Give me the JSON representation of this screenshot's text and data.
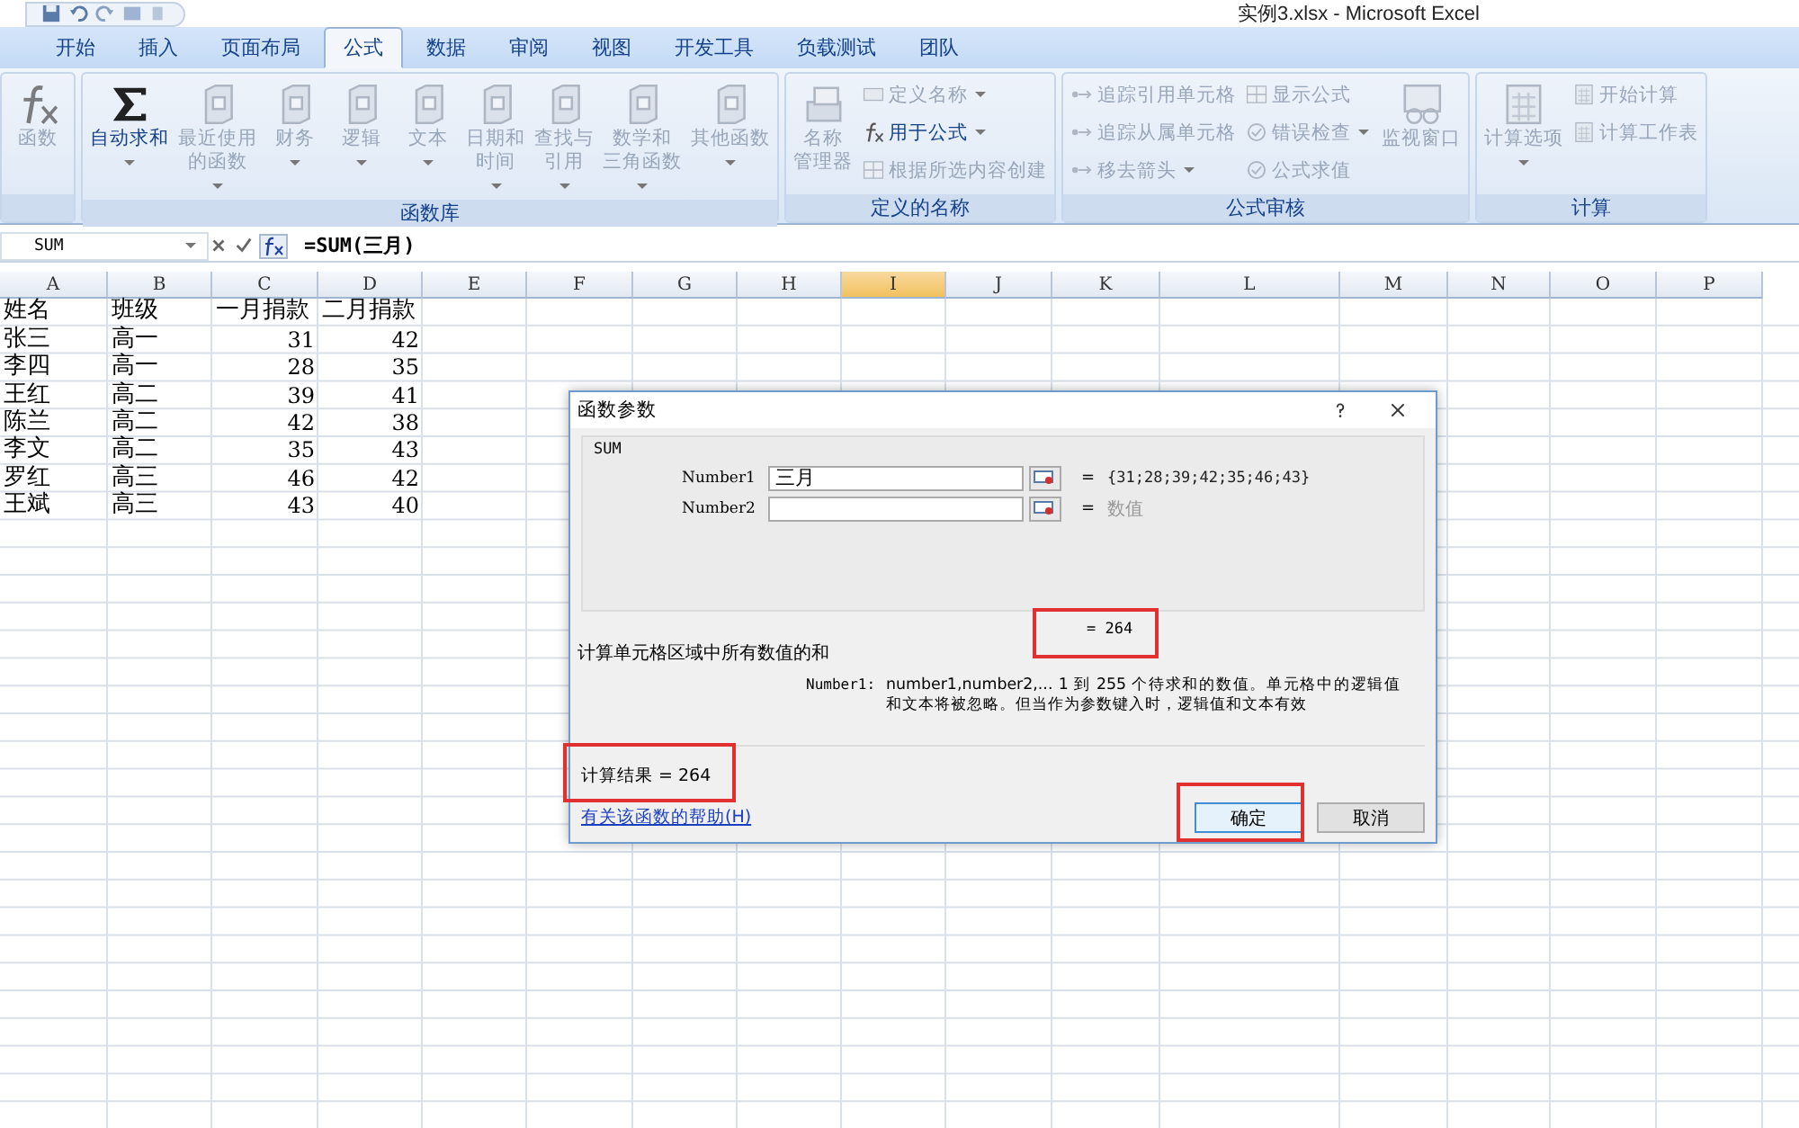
{
  "window": {
    "title": "实例3.xlsx - Microsoft Excel"
  },
  "tabs": [
    {
      "label": "开始",
      "selected": false
    },
    {
      "label": "插入",
      "selected": false
    },
    {
      "label": "页面布局",
      "selected": false
    },
    {
      "label": "公式",
      "selected": true
    },
    {
      "label": "数据",
      "selected": false
    },
    {
      "label": "审阅",
      "selected": false
    },
    {
      "label": "视图",
      "selected": false
    },
    {
      "label": "开发工具",
      "selected": false
    },
    {
      "label": "负载测试",
      "selected": false
    },
    {
      "label": "团队",
      "selected": false
    }
  ],
  "ribbon": [
    {
      "items": [
        {
          "kind": "big",
          "lines": [
            "函数"
          ],
          "disabled": true,
          "dropdown": false
        }
      ]
    },
    {
      "label": "函数库",
      "items": [
        {
          "kind": "big",
          "lines": [
            "自动求和"
          ],
          "disabled": false,
          "dropdown": true
        },
        {
          "kind": "big",
          "lines": [
            "最近使用",
            "的函数"
          ],
          "disabled": true,
          "dropdown": true
        },
        {
          "kind": "big",
          "lines": [
            "财务"
          ],
          "disabled": true,
          "dropdown": true
        },
        {
          "kind": "big",
          "lines": [
            "逻辑"
          ],
          "disabled": true,
          "dropdown": true
        },
        {
          "kind": "big",
          "lines": [
            "文本"
          ],
          "disabled": true,
          "dropdown": true
        },
        {
          "kind": "big",
          "lines": [
            "日期和",
            "时间"
          ],
          "disabled": true,
          "dropdown": true
        },
        {
          "kind": "big",
          "lines": [
            "查找与",
            "引用"
          ],
          "disabled": true,
          "dropdown": true
        },
        {
          "kind": "big",
          "lines": [
            "数学和",
            "三角函数"
          ],
          "disabled": true,
          "dropdown": true
        },
        {
          "kind": "big",
          "lines": [
            "其他函数"
          ],
          "disabled": true,
          "dropdown": true
        }
      ]
    },
    {
      "label": "定义的名称",
      "items": [
        {
          "kind": "big",
          "lines": [
            "名称",
            "管理器"
          ],
          "disabled": true,
          "dropdown": false
        },
        {
          "kind": "small",
          "lines": [
            "定义名称"
          ],
          "disabled": true,
          "dropdown": true
        },
        {
          "kind": "small",
          "lines": [
            "用于公式"
          ],
          "disabled": false,
          "dropdown": true
        },
        {
          "kind": "small",
          "lines": [
            "根据所选内容创建"
          ],
          "disabled": true,
          "dropdown": false
        }
      ]
    },
    {
      "label": "公式审核",
      "items": [
        {
          "kind": "small",
          "lines": [
            "追踪引用单元格"
          ],
          "disabled": true,
          "dropdown": false
        },
        {
          "kind": "small",
          "lines": [
            "追踪从属单元格"
          ],
          "disabled": true,
          "dropdown": false
        },
        {
          "kind": "small",
          "lines": [
            "移去箭头"
          ],
          "disabled": true,
          "dropdown": true
        },
        {
          "kind": "small",
          "lines": [
            "显示公式"
          ],
          "disabled": true,
          "dropdown": false
        },
        {
          "kind": "small",
          "lines": [
            "错误检查"
          ],
          "disabled": true,
          "dropdown": true
        },
        {
          "kind": "small",
          "lines": [
            "公式求值"
          ],
          "disabled": true,
          "dropdown": false
        },
        {
          "kind": "big",
          "lines": [
            "监视窗口"
          ],
          "disabled": true,
          "dropdown": false
        }
      ]
    },
    {
      "label": "计算",
      "items": [
        {
          "kind": "big",
          "lines": [
            "计算选项"
          ],
          "disabled": true,
          "dropdown": true
        },
        {
          "kind": "small",
          "lines": [
            "开始计算"
          ],
          "disabled": true,
          "dropdown": false
        },
        {
          "kind": "small",
          "lines": [
            "计算工作表"
          ],
          "disabled": true,
          "dropdown": false
        }
      ]
    }
  ],
  "formula_bar": {
    "name_box": "SUM",
    "formula": "=SUM(三月)"
  },
  "sheet": {
    "columns": [
      {
        "label": "A",
        "selected": false
      },
      {
        "label": "B",
        "selected": false
      },
      {
        "label": "C",
        "selected": false
      },
      {
        "label": "D",
        "selected": false
      },
      {
        "label": "E",
        "selected": false
      },
      {
        "label": "F",
        "selected": false
      },
      {
        "label": "G",
        "selected": false
      },
      {
        "label": "H",
        "selected": false
      },
      {
        "label": "I",
        "selected": true
      },
      {
        "label": "J",
        "selected": false
      },
      {
        "label": "K",
        "selected": false
      },
      {
        "label": "L",
        "selected": false
      },
      {
        "label": "M",
        "selected": false
      },
      {
        "label": "N",
        "selected": false
      },
      {
        "label": "O",
        "selected": false
      },
      {
        "label": "P",
        "selected": false
      }
    ],
    "rows": [
      [
        "姓名",
        "班级",
        "一月捐款",
        "二月捐款"
      ],
      [
        "张三",
        "高一",
        "31",
        "42"
      ],
      [
        "李四",
        "高一",
        "28",
        "35"
      ],
      [
        "王红",
        "高二",
        "39",
        "41"
      ],
      [
        "陈兰",
        "高二",
        "42",
        "38"
      ],
      [
        "李文",
        "高二",
        "35",
        "43"
      ],
      [
        "罗红",
        "高三",
        "46",
        "42"
      ],
      [
        "王斌",
        "高三",
        "43",
        "40"
      ]
    ]
  },
  "dialog": {
    "title": "函数参数",
    "function": "SUM",
    "arguments": [
      {
        "label": "Number1",
        "value": "三月",
        "equals": "=",
        "result": "{31;28;39;42;35;46;43}",
        "result_muted": false
      },
      {
        "label": "Number2",
        "equals": "=",
        "result": "数值",
        "result_muted": true
      }
    ],
    "formula_result": "= 264",
    "description": "计算单元格区域中所有数值的和",
    "arg_help_label": "Number1:",
    "arg_help": "number1,number2,...  1 到 255 个待求和的数值。单元格中的逻辑值和文本将被忽略。但当作为参数键入时，逻辑值和文本有效",
    "result_line": "计算结果 = 264",
    "help_link": "有关该函数的帮助(H)",
    "buttons": [
      {
        "label": "确定",
        "default": true
      },
      {
        "label": "取消",
        "default": false
      }
    ]
  }
}
